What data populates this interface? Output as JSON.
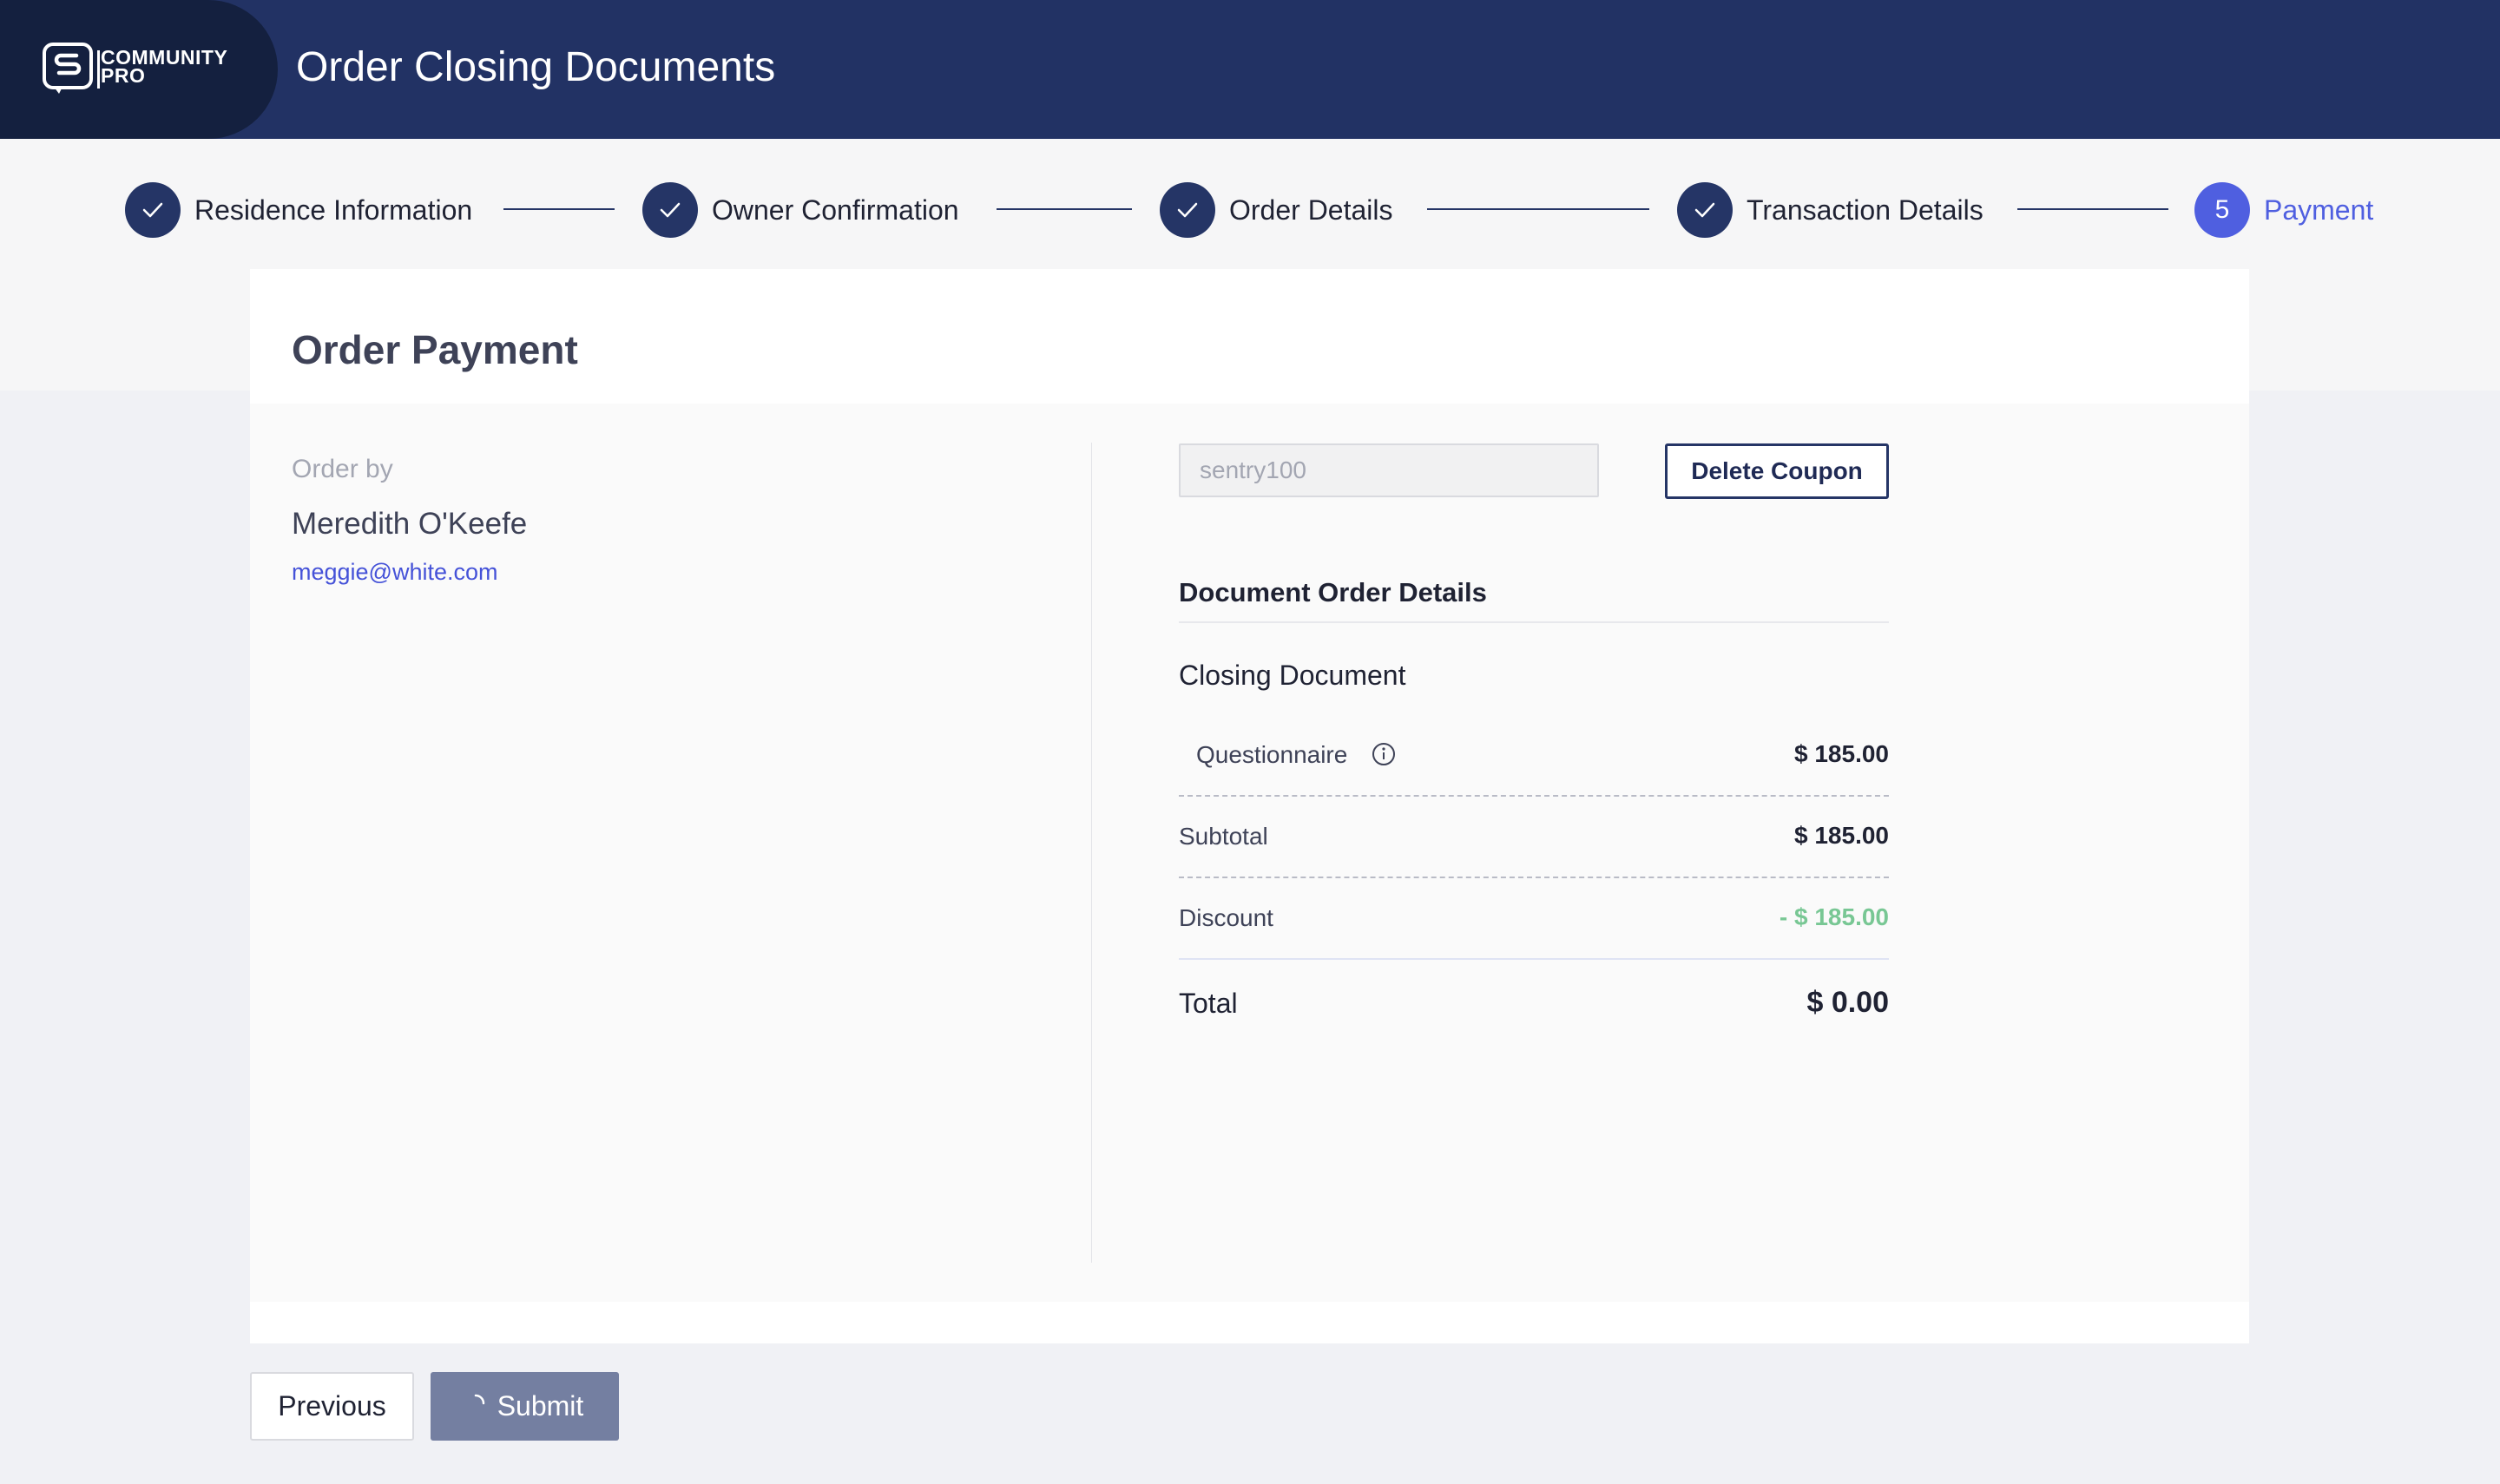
{
  "header": {
    "logo_line1": "COMMUNITY",
    "logo_line2": "PRO",
    "title": "Order Closing Documents"
  },
  "stepper": {
    "steps": [
      {
        "label": "Residence Information",
        "status": "complete"
      },
      {
        "label": "Owner Confirmation",
        "status": "complete"
      },
      {
        "label": "Order Details",
        "status": "complete"
      },
      {
        "label": "Transaction Details",
        "status": "complete"
      },
      {
        "number": "5",
        "label": "Payment",
        "status": "active"
      }
    ]
  },
  "card": {
    "title": "Order Payment"
  },
  "order_by": {
    "label": "Order by",
    "name": "Meredith O'Keefe",
    "email": "meggie@white.com"
  },
  "coupon": {
    "value": "sentry100",
    "button_label": "Delete Coupon"
  },
  "details": {
    "heading": "Document Order Details",
    "section": "Closing Document",
    "items": [
      {
        "label": "Questionnaire",
        "value": "$ 185.00"
      }
    ],
    "subtotal_label": "Subtotal",
    "subtotal_value": "$ 185.00",
    "discount_label": "Discount",
    "discount_value": "- $ 185.00",
    "total_label": "Total",
    "total_value": "$ 0.00"
  },
  "actions": {
    "previous_label": "Previous",
    "submit_label": "Submit"
  },
  "colors": {
    "header_bg": "#223264",
    "logo_bg": "#14203f",
    "step_complete": "#253566",
    "step_active": "#4f5fe0",
    "discount": "#78c794",
    "submit_bg": "#747fa1"
  },
  "icons": [
    "logo-icon",
    "check-icon",
    "info-icon",
    "spinner-icon"
  ]
}
